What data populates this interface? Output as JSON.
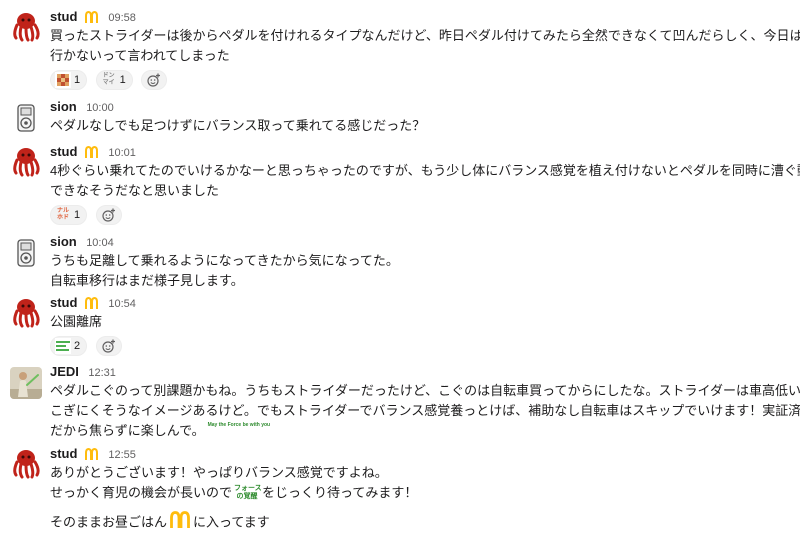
{
  "messages": [
    {
      "author": "stud",
      "time": "09:58",
      "lines": [
        "買ったストライダーは後からペダルを付けれるタイプなんだけど、昨日ペダル付けてみたら全然できなくて凹んだらしく、今日は公園",
        "行かないって言われてしまった"
      ],
      "reactions": [
        {
          "emoji": "mosaic-emoji",
          "count": "1"
        },
        {
          "emoji": "donmai-emoji",
          "text": "ドン\nマイ",
          "count": "1"
        }
      ]
    },
    {
      "author": "sion",
      "time": "10:00",
      "lines": [
        "ペダルなしでも足つけずにバランス取って乗れてる感じだった？"
      ]
    },
    {
      "author": "stud",
      "time": "10:01",
      "lines": [
        "4秒ぐらい乗れてたのでいけるかなーと思っちゃったのですが、もう少し体にバランス感覚を植え付けないとペダルを同時に漕ぐ動作が",
        "できなそうだなと思いました"
      ],
      "reactions": [
        {
          "emoji": "naruhodo-emoji",
          "text": "ナル\nホド",
          "count": "1"
        }
      ]
    },
    {
      "author": "sion",
      "time": "10:04",
      "lines": [
        "うちも足離して乗れるようになってきたから気になってた。",
        "自転車移行はまだ様子見します。"
      ]
    },
    {
      "author": "stud",
      "time": "10:54",
      "lines": [
        "公園離席"
      ],
      "reactions": [
        {
          "emoji": "green-text-emoji",
          "count": "2"
        }
      ]
    },
    {
      "author": "JEDI",
      "time": "12:31",
      "lines": [
        "ペダルこぐのって別課題かもね。うちもストライダーだったけど、こぐのは自転車買ってからにしたな。ストライダーは車高低いから、",
        "こぎにくそうなイメージあるけど。でもストライダーでバランス感覚養っとけば、補助なし自転車はスキップでいけます！実証済み。",
        "だから焦らずに楽しんで。"
      ],
      "inline_emoji_text": "May the Force be with you"
    },
    {
      "author": "stud",
      "time": "12:55",
      "lines": [
        "ありがとうございます！やっぱりバランス感覚ですよね。"
      ],
      "line2_before": "せっかく育児の機会が長いので",
      "line2_emoji_text": "フォース\nの覚醒",
      "line2_after": "をじっくり待ってみます！",
      "line3_before": "そのままお昼ごはん",
      "line3_after": "に入ってます"
    }
  ],
  "colors": {
    "mcd_gold": "#ffbc0d",
    "mcd_red": "#da291c",
    "octopus_red": "#c0231a"
  }
}
